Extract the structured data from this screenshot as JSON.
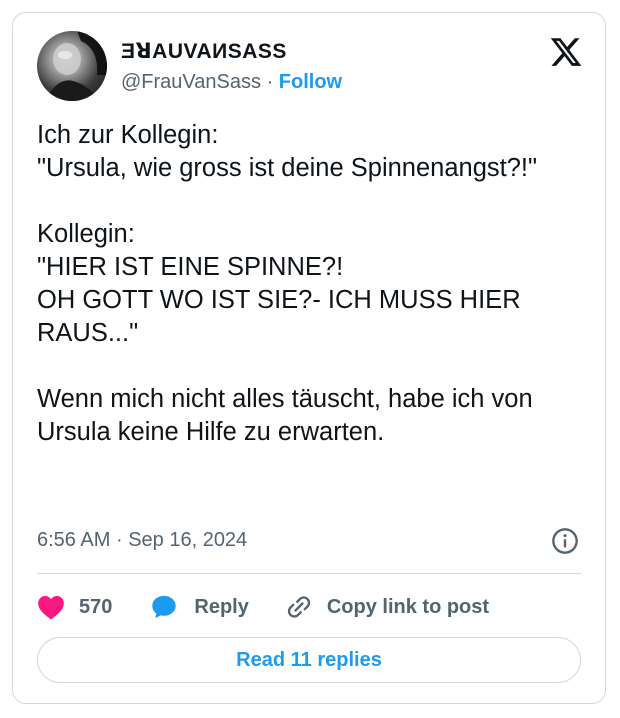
{
  "author": {
    "display_name": "ƎꓤAUVAИSASS",
    "handle": "@FrauVanSass",
    "separator": "·",
    "follow_label": "Follow"
  },
  "tweet": {
    "paragraphs": [
      "Ich zur Kollegin:\n\"Ursula, wie gross ist deine Spinnenangst?!\"",
      "Kollegin:\n\"HIER IST EINE SPINNE?!\nOH GOTT WO IST SIE?- ICH MUSS HIER RAUS...\"",
      "Wenn mich nicht alles täuscht, habe ich von Ursula keine Hilfe zu erwarten."
    ],
    "time": "6:56 AM",
    "date_separator": "·",
    "date": "Sep 16, 2024"
  },
  "actions": {
    "like_count": "570",
    "reply_label": "Reply",
    "copy_label": "Copy link to post"
  },
  "footer": {
    "read_replies_label": "Read 11 replies"
  },
  "colors": {
    "accent": "#1d9bf0",
    "heart": "#f91880",
    "muted": "#536471",
    "border": "#cfd9de"
  },
  "icons": {
    "logo": "x-logo-icon",
    "info": "info-icon",
    "like": "heart-icon",
    "reply": "speech-bubble-icon",
    "copy": "link-icon"
  }
}
